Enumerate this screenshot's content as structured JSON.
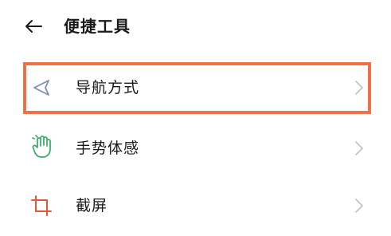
{
  "header": {
    "title": "便捷工具",
    "back_icon": "arrow-left-icon"
  },
  "items": [
    {
      "label": "导航方式",
      "icon": "navigation-triangle-icon",
      "icon_color": "#7b8fb0",
      "chevron_icon": "chevron-right-icon",
      "highlighted": true
    },
    {
      "label": "手势体感",
      "icon": "hand-gesture-icon",
      "icon_color": "#3fae6b",
      "chevron_icon": "chevron-right-icon",
      "highlighted": false
    },
    {
      "label": "截屏",
      "icon": "crop-icon",
      "icon_color": "#e5553b",
      "chevron_icon": "chevron-right-icon",
      "highlighted": false
    }
  ],
  "colors": {
    "highlight_border": "#f07145",
    "chevron": "#c4c4c4",
    "text": "#1a1a1a",
    "background": "#ffffff"
  }
}
